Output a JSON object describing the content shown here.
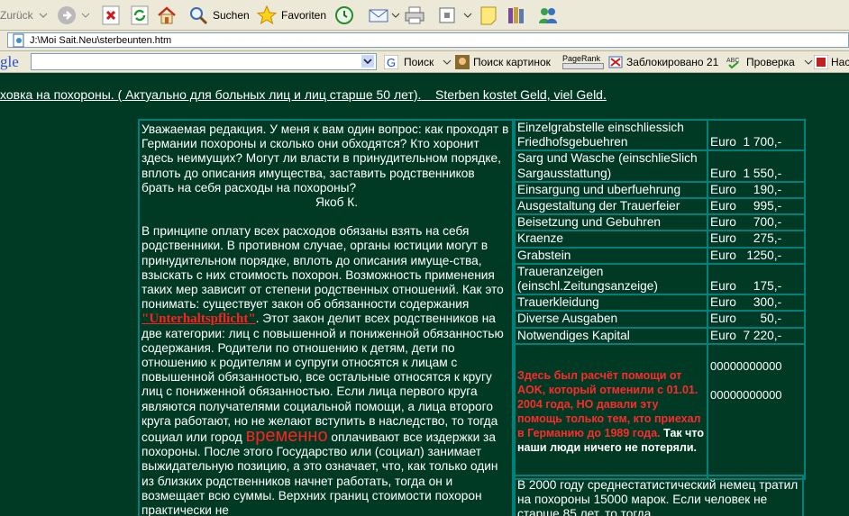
{
  "toolbar": {
    "back_label": "Zurück",
    "search_label": "Suchen",
    "favorites_label": "Favoriten"
  },
  "address": {
    "url": "J:\\Moi Sait.Neu\\sterbeunten.htm"
  },
  "google_bar": {
    "brand": "gle",
    "search_label": "Поиск",
    "image_search_label": "Поиск картинок",
    "pagerank_label": "PageRank",
    "blocked_label": "Заблокировано 21",
    "check_label": "Проверка",
    "settings_label": "Нас"
  },
  "page": {
    "marquee_a": "ховка на похороны. ( Актуально для больных  лиц и лиц старше 50 лет).",
    "marquee_b": "Sterben kostet Geld, viel Geld.",
    "question": "Уважаемая редакция. У меня к вам один вопрос: как проходят в Германии похороны и  сколько они обходятся? Кто хоронит здесь неимущих? Могут ли власти в принудительном порядке, вплоть до описания имущества, заставить родственников брать на себя расходы на похороны?",
    "question_signature": "Якоб К.",
    "answer_part1": "В принципе оплату всех расходов обязаны взять на себя родственники. В противном случае, органы юстиции могут в принудительном порядке, вплоть до описания имуще-ства, взыскать с них стоимость похорон. Возможность применения таких мер зависит от степени родственных отношений. Как это понимать: существует закон об обязанности содержания",
    "answer_link": "\"Unterhaltspflicht\"",
    "answer_part2": ". Этот закон делит всех родственников на две категории: лиц  с повышенной и пониженной обязанностью содержания. Родители по отношению к детям, дети по  отношению к родителям и супруги относятся к лицам с повышенной обязанностью, все остальные относятся к кругу лиц с пониженной обязанностью.  Если лица первого круга являются получателями социальной помощи, а лица второго круга работают, но не желают вступить в наследство, то тогда  социал  или город",
    "answer_highlight": "временно",
    "answer_part3": "оплачивают все издержки за похороны. После этого Государство или (социал) занимает выжидательную позицию, а это означает, что, как только один из близких родственников начнет работать, тогда он и возмещает всю суммы. Верхних границ стоимости похорон практически не",
    "cost_rows": [
      {
        "item": "Einzelgrabstelle einschliessich Friedhofsgebuehren",
        "value": "Euro  1 700,-"
      },
      {
        "item": "Sarg und Wasche (einschlieSlich Sargausstattung)",
        "value": "Euro  1 550,-"
      },
      {
        "item": "Einsargung und uberfuehrung",
        "value": "Euro     190,-"
      },
      {
        "item": "Ausgestaltung der Trauerfeier",
        "value": "Euro     995,-"
      },
      {
        "item": "Beisetzung und Gebuhren",
        "value": "Euro     700,-"
      },
      {
        "item": "Kraenze",
        "value": "Euro     275,-"
      },
      {
        "item": "Grabstein",
        "value": "Euro   1250,-"
      },
      {
        "item": "Traueranzeigen (einschl.Zeitungsanzeige)",
        "value": "Euro     175,-"
      },
      {
        "item": "Trauerkleidung",
        "value": "Euro     300,-"
      },
      {
        "item": "Diverse Ausgaben",
        "value": "Euro       50,-"
      },
      {
        "item": "Notwendiges Kapital",
        "value": "Euro  7 220,-"
      }
    ],
    "note_red": "Здесь был расчёт помощи от AOK, который отменили с 01.01. 2004 года, НО давали эту помощь только тем, кто приехал в Германию до 1989 года.",
    "note_white": "Так что наши люди ничего не потеряли.",
    "zeros_1": "00000000000",
    "zeros_2": "00000000000",
    "info_text": "В 2000 году среднестатистический немец тратил на похороны 15000 марок. Если человек не старше 85 лет, то тогда"
  }
}
